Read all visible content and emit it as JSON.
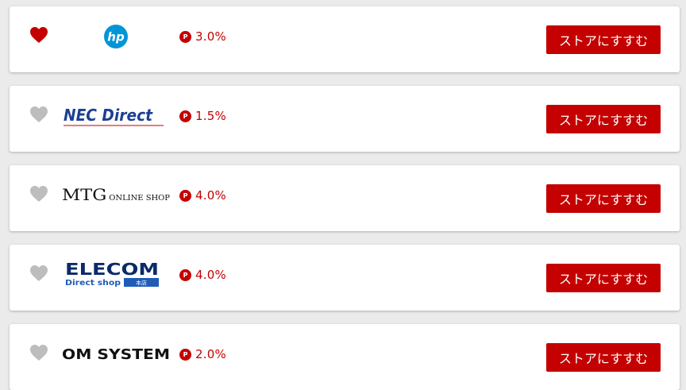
{
  "stores": [
    {
      "name": "hp",
      "favorited": true,
      "logo_text": "hp",
      "rate": "3.0%",
      "button_label": "ストアにすすむ"
    },
    {
      "name": "NEC Direct",
      "favorited": false,
      "logo_text": "NEC Direct",
      "rate": "1.5%",
      "button_label": "ストアにすすむ"
    },
    {
      "name": "MTG ONLINE SHOP",
      "favorited": false,
      "logo_text_main": "MTG",
      "logo_text_sub": "ONLINE SHOP",
      "rate": "4.0%",
      "button_label": "ストアにすすむ"
    },
    {
      "name": "ELECOM Direct shop",
      "favorited": false,
      "logo_text_main": "ELECOM",
      "logo_text_sub": "Direct shop",
      "logo_text_tag": "本店",
      "rate": "4.0%",
      "button_label": "ストアにすすむ"
    },
    {
      "name": "OM SYSTEM",
      "favorited": false,
      "logo_text": "OM SYSTEM",
      "rate": "2.0%",
      "button_label": "ストアにすすむ"
    }
  ],
  "point_badge": "P",
  "colors": {
    "accent": "#c40000",
    "heart_active": "#c40000",
    "heart_inactive": "#bdbdbd"
  },
  "icons": {
    "favorite": "heart-icon",
    "points": "point-badge-icon"
  }
}
